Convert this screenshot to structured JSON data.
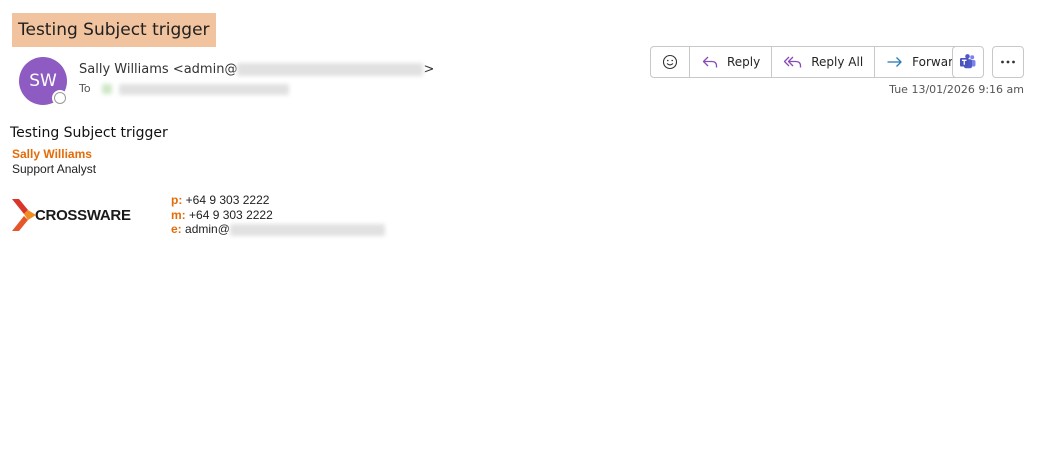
{
  "message": {
    "subject": "Testing Subject trigger",
    "sender_initials": "SW",
    "sender_display": "Sally Williams <admin@",
    "sender_close": ">",
    "to_label": "To",
    "date": "Tue 13/01/2026 9:16 am"
  },
  "toolbar": {
    "reply_label": "Reply",
    "reply_all_label": "Reply All",
    "forward_label": "Forward"
  },
  "body": {
    "text": "Testing Subject trigger"
  },
  "signature": {
    "name": "Sally Williams",
    "role": "Support Analyst",
    "logo_text": "CROSSWARE",
    "phone_key": "p:",
    "phone": "+64 9 303 2222",
    "mobile_key": "m:",
    "mobile": "+64 9 303 2222",
    "email_key": "e:",
    "email": "admin@"
  },
  "colors": {
    "subject_highlight": "#f1c39f",
    "avatar": "#8d5bc1",
    "signature_accent": "#e36c0a"
  }
}
